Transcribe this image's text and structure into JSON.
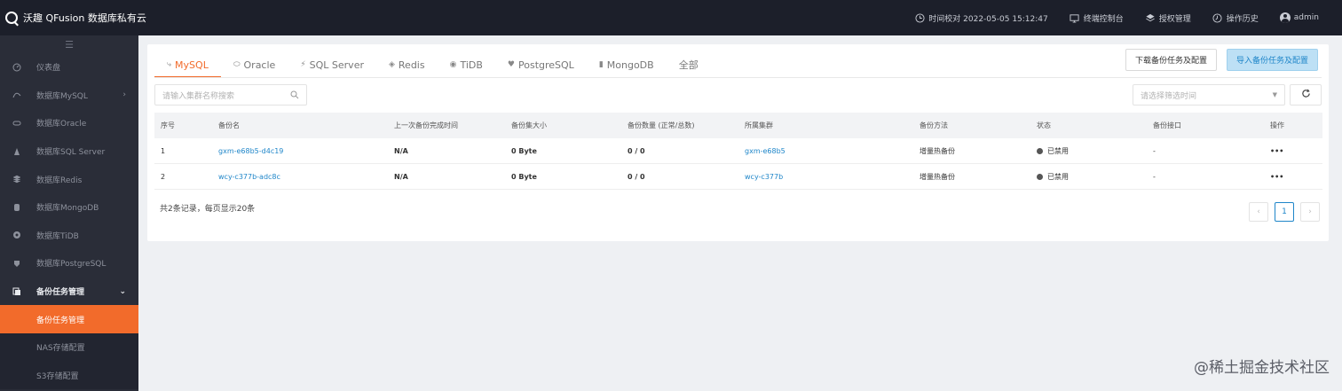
{
  "app": {
    "title": "沃趣 QFusion 数据库私有云"
  },
  "topbar": {
    "items": [
      {
        "icon": "clock-icon",
        "label": "时间校对 2022-05-05 15:12:47"
      },
      {
        "icon": "monitor-icon",
        "label": "终端控制台"
      },
      {
        "icon": "layers-icon",
        "label": "授权管理"
      },
      {
        "icon": "history-icon",
        "label": "操作历史"
      },
      {
        "icon": "user-icon",
        "label": "admin"
      }
    ]
  },
  "sidebar": {
    "collapse_label": "☰",
    "items": [
      {
        "icon": "dashboard-icon",
        "label": "仪表盘"
      },
      {
        "icon": "mysql-icon",
        "label": "数据库MySQL",
        "chevron": "›"
      },
      {
        "icon": "oracle-icon",
        "label": "数据库Oracle"
      },
      {
        "icon": "sqlserver-icon",
        "label": "数据库SQL Server"
      },
      {
        "icon": "redis-icon",
        "label": "数据库Redis"
      },
      {
        "icon": "mongodb-icon",
        "label": "数据库MongoDB"
      },
      {
        "icon": "tidb-icon",
        "label": "数据库TiDB"
      },
      {
        "icon": "postgresql-icon",
        "label": "数据库PostgreSQL"
      },
      {
        "icon": "backup-icon",
        "label": "备份任务管理",
        "chevron": "⌄"
      },
      {
        "label": "备份任务管理"
      },
      {
        "label": "NAS存储配置"
      },
      {
        "label": "S3存储配置"
      }
    ]
  },
  "tabs": [
    {
      "icon": "mysql-icon",
      "label": "MySQL"
    },
    {
      "icon": "oracle-icon",
      "label": "Oracle"
    },
    {
      "icon": "sqlserver-icon",
      "label": "SQL Server"
    },
    {
      "icon": "redis-icon",
      "label": "Redis"
    },
    {
      "icon": "tidb-icon",
      "label": "TiDB"
    },
    {
      "icon": "postgresql-icon",
      "label": "PostgreSQL"
    },
    {
      "icon": "mongodb-icon",
      "label": "MongoDB"
    },
    {
      "label": "全部"
    }
  ],
  "actions": {
    "download": "下载备份任务及配置",
    "import": "导入备份任务及配置"
  },
  "search": {
    "placeholder": "请输入集群名称搜索"
  },
  "time_filter": {
    "placeholder": "请选择筛选时间"
  },
  "table": {
    "headers": [
      "序号",
      "备份名",
      "上一次备份完成时间",
      "备份集大小",
      "备份数量 (正常/总数)",
      "所属集群",
      "备份方法",
      "状态",
      "备份接口",
      "操作"
    ],
    "rows": [
      [
        "1",
        "gxm-e68b5-d4c19",
        "N/A",
        "0 Byte",
        "0 / 0",
        "gxm-e68b5",
        "增量热备份",
        "已禁用",
        "-",
        "•••"
      ],
      [
        "2",
        "wcy-c377b-adc8c",
        "N/A",
        "0 Byte",
        "0 / 0",
        "wcy-c377b",
        "增量热备份",
        "已禁用",
        "-",
        "•••"
      ]
    ]
  },
  "footer": {
    "summary": "共2条记录，每页显示20条",
    "prev": "‹",
    "page": "1",
    "next": "›"
  },
  "watermark": "@稀土掘金技术社区",
  "colors": {
    "accent": "#f26b2b",
    "link": "#1f86c9",
    "topbar_bg": "#1c1f2a",
    "sidebar_bg": "#2a2d38"
  }
}
